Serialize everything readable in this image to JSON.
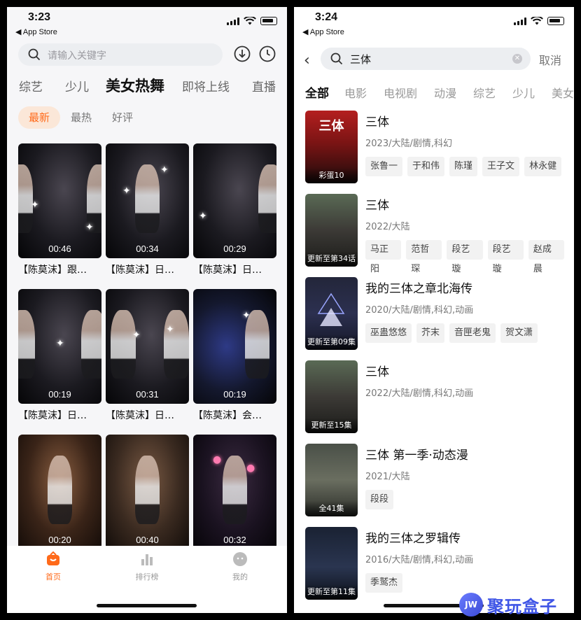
{
  "left": {
    "status": {
      "time": "3:23",
      "back_app": "◀ App Store"
    },
    "search": {
      "placeholder": "请输入关键字"
    },
    "tabs": [
      "综艺",
      "少儿",
      "美女热舞",
      "即将上线",
      "直播"
    ],
    "active_tab": "美女热舞",
    "sort": [
      "最新",
      "最热",
      "好评"
    ],
    "videos": [
      {
        "duration": "00:46",
        "title": "【陈莫沫】跟…"
      },
      {
        "duration": "00:34",
        "title": "【陈莫沫】日…"
      },
      {
        "duration": "00:29",
        "title": "【陈莫沫】日…"
      },
      {
        "duration": "00:19",
        "title": "【陈莫沫】日…"
      },
      {
        "duration": "00:31",
        "title": "【陈莫沫】日…"
      },
      {
        "duration": "00:19",
        "title": "【陈莫沫】会…"
      },
      {
        "duration": "00:20",
        "title": ""
      },
      {
        "duration": "00:40",
        "title": ""
      },
      {
        "duration": "00:32",
        "title": ""
      }
    ],
    "bottom_nav": [
      {
        "label": "首页",
        "icon": "home-icon",
        "active": true
      },
      {
        "label": "排行榜",
        "icon": "ranking-icon",
        "active": false
      },
      {
        "label": "我的",
        "icon": "profile-icon",
        "active": false
      }
    ]
  },
  "right": {
    "status": {
      "time": "3:24",
      "back_app": "◀ App Store"
    },
    "search": {
      "value": "三体",
      "cancel": "取消"
    },
    "categories": [
      "全部",
      "电影",
      "电视剧",
      "动漫",
      "综艺",
      "少儿",
      "美女"
    ],
    "results": [
      {
        "title": "三体",
        "meta": "2023/大陆/剧情,科幻",
        "poster_caption": "彩蛋10",
        "poster_text": "三体",
        "cast": [
          "张鲁一",
          "于和伟",
          "陈瑾",
          "王子文",
          "林永健"
        ]
      },
      {
        "title": "三体",
        "meta": "2022/大陆",
        "poster_caption": "更新至第34话",
        "poster_text": "",
        "cast": [
          "马正阳",
          "范哲琛",
          "段艺璇",
          "段艺璇",
          "赵成晨"
        ]
      },
      {
        "title": "我的三体之章北海传",
        "meta": "2020/大陆/剧情,科幻,动画",
        "poster_caption": "更新至第09集",
        "poster_text": "",
        "cast": [
          "巫蛊悠悠",
          "芥末",
          "音匣老鬼",
          "贺文潇"
        ]
      },
      {
        "title": "三体",
        "meta": "2022/大陆/剧情,科幻,动画",
        "poster_caption": "更新至15集",
        "poster_text": "",
        "cast": []
      },
      {
        "title": "三体 第一季·动态漫",
        "meta": "2021/大陆",
        "poster_caption": "全41集",
        "poster_text": "",
        "cast": [
          "段段"
        ]
      },
      {
        "title": "我的三体之罗辑传",
        "meta": "2016/大陆/剧情,科幻,动画",
        "poster_caption": "更新至第11集",
        "poster_text": "",
        "cast": [
          "季鹫杰"
        ]
      }
    ]
  },
  "watermark": {
    "badge": "JW",
    "text": "聚玩盒子"
  },
  "colors": {
    "accent": "#ff6a1a",
    "accent_bg": "#fbe7d8",
    "watermark": "#3f55e6"
  }
}
